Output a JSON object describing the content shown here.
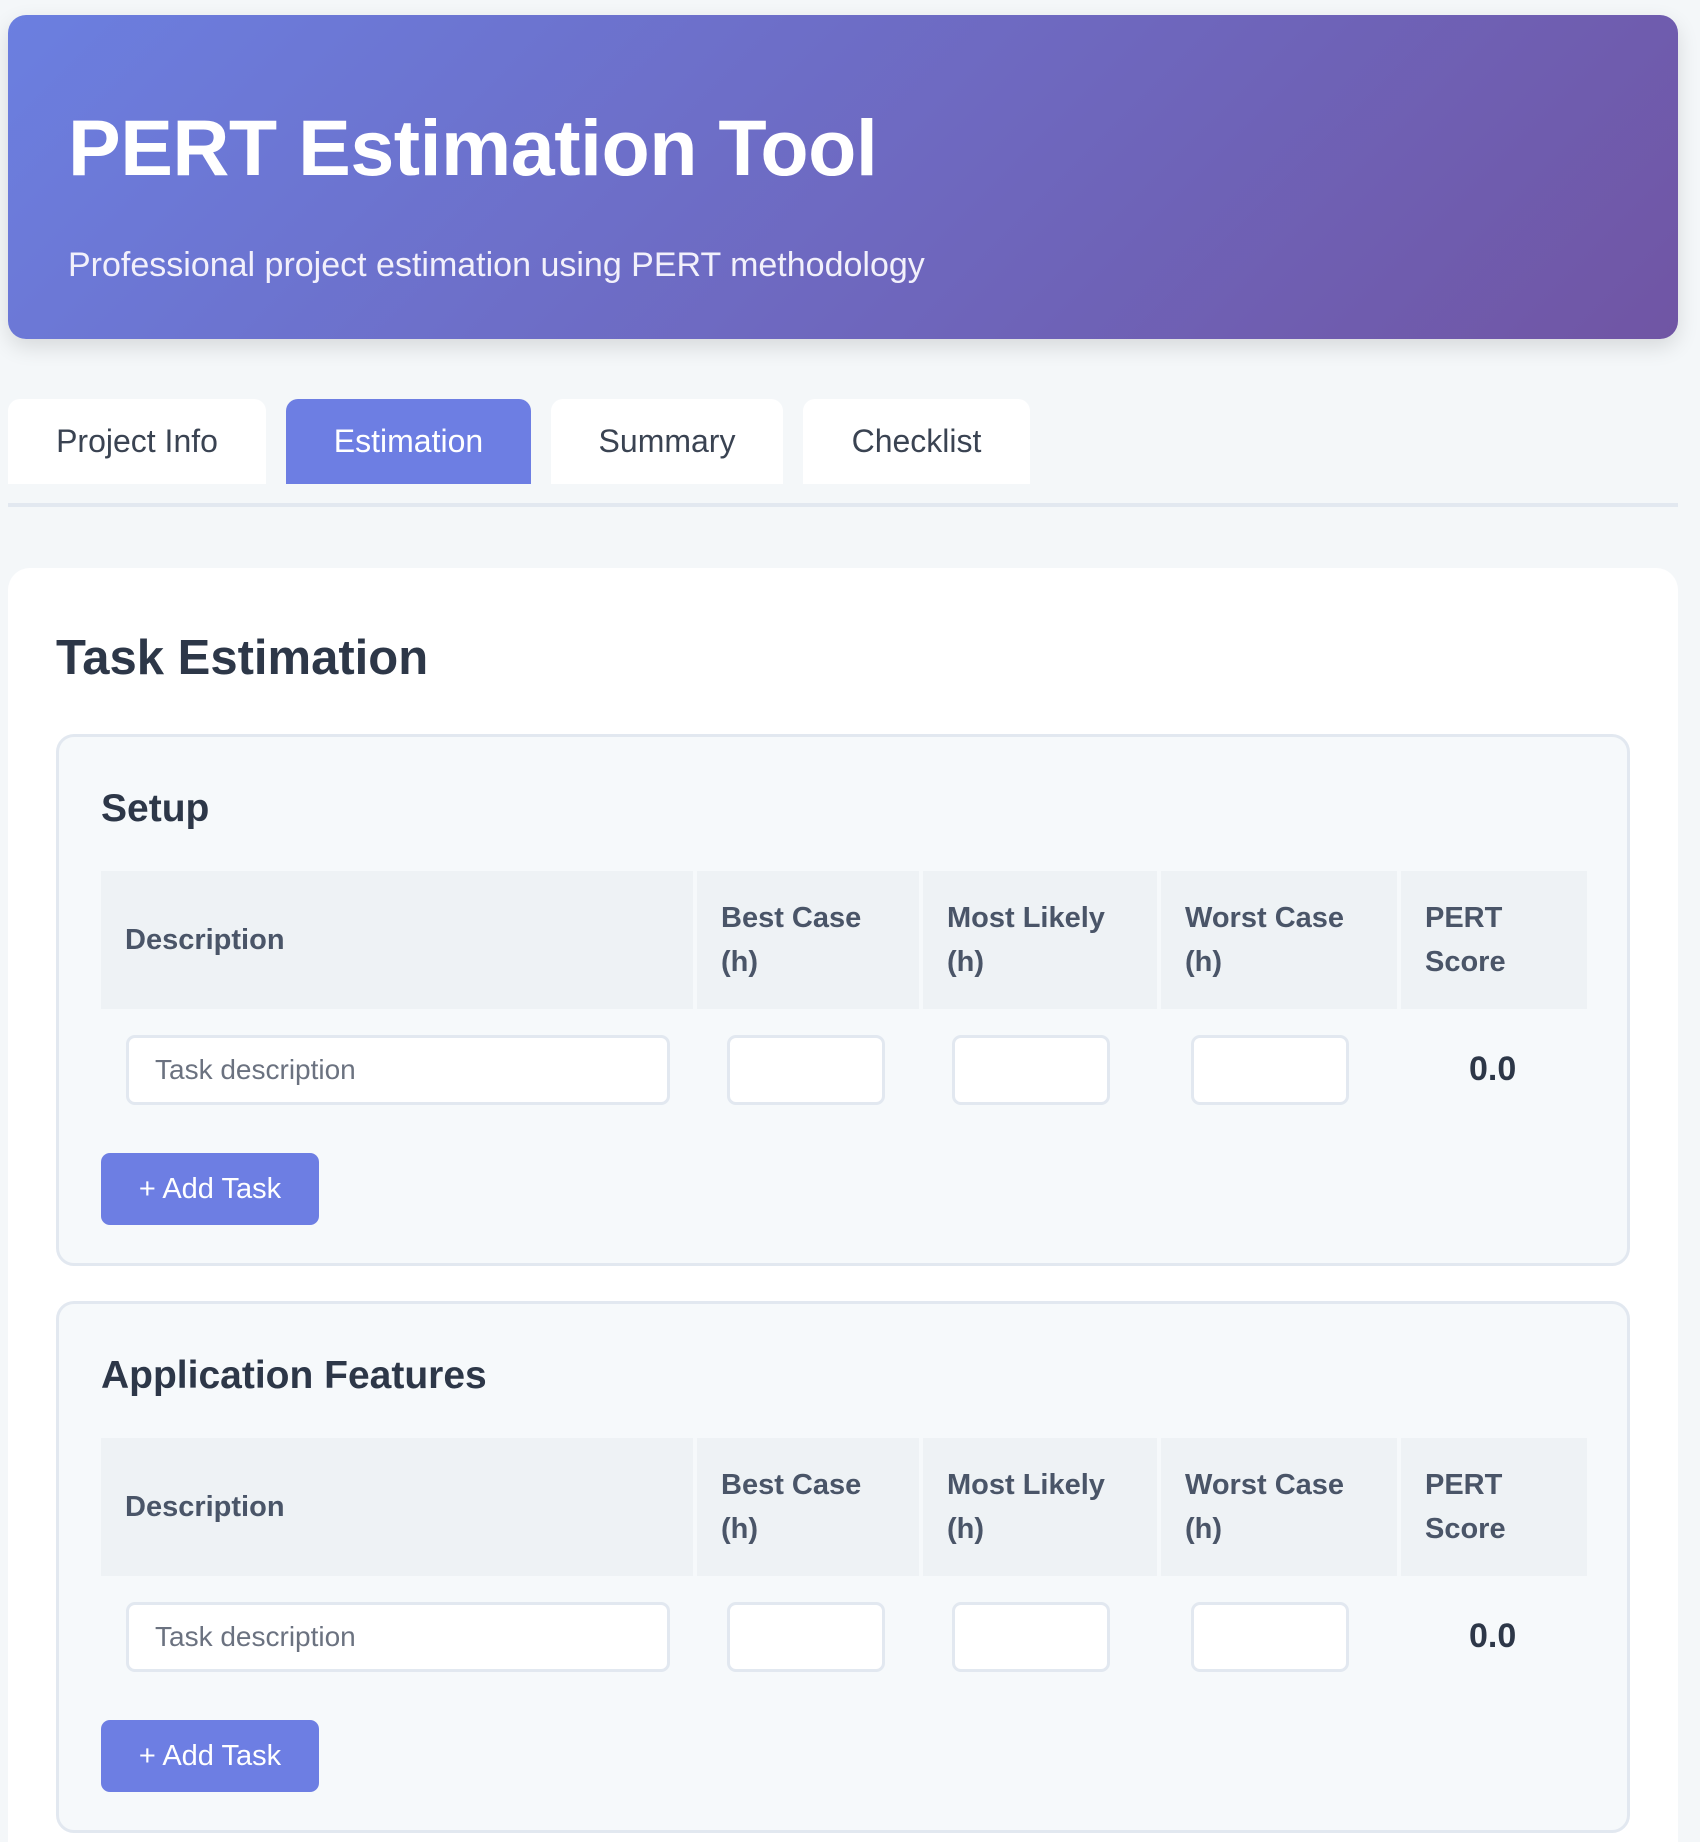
{
  "header": {
    "title": "PERT Estimation Tool",
    "subtitle": "Professional project estimation using PERT methodology"
  },
  "tabs": [
    {
      "label": "Project Info",
      "active": false
    },
    {
      "label": "Estimation",
      "active": true
    },
    {
      "label": "Summary",
      "active": false
    },
    {
      "label": "Checklist",
      "active": false
    }
  ],
  "estimation": {
    "title": "Task Estimation",
    "columns": {
      "description": "Description",
      "best_case": [
        "Best Case",
        "(h)"
      ],
      "most_likely": [
        "Most Likely",
        "(h)"
      ],
      "worst_case": [
        "Worst Case",
        "(h)"
      ],
      "pert_score": [
        "PERT",
        "Score"
      ]
    },
    "sections": [
      {
        "name": "Setup",
        "tasks": [
          {
            "description_placeholder": "Task description",
            "description": "",
            "best": "",
            "likely": "",
            "worst": "",
            "pert": "0.0"
          }
        ],
        "add_label": "+ Add Task"
      },
      {
        "name": "Application Features",
        "tasks": [
          {
            "description_placeholder": "Task description",
            "description": "",
            "best": "",
            "likely": "",
            "worst": "",
            "pert": "0.0"
          }
        ],
        "add_label": "+ Add Task"
      }
    ]
  },
  "colors": {
    "accent": "#6d7ee3",
    "header_gradient_start": "#6b7fe0",
    "header_gradient_end": "#7055a4",
    "background": "#f4f7f9"
  }
}
